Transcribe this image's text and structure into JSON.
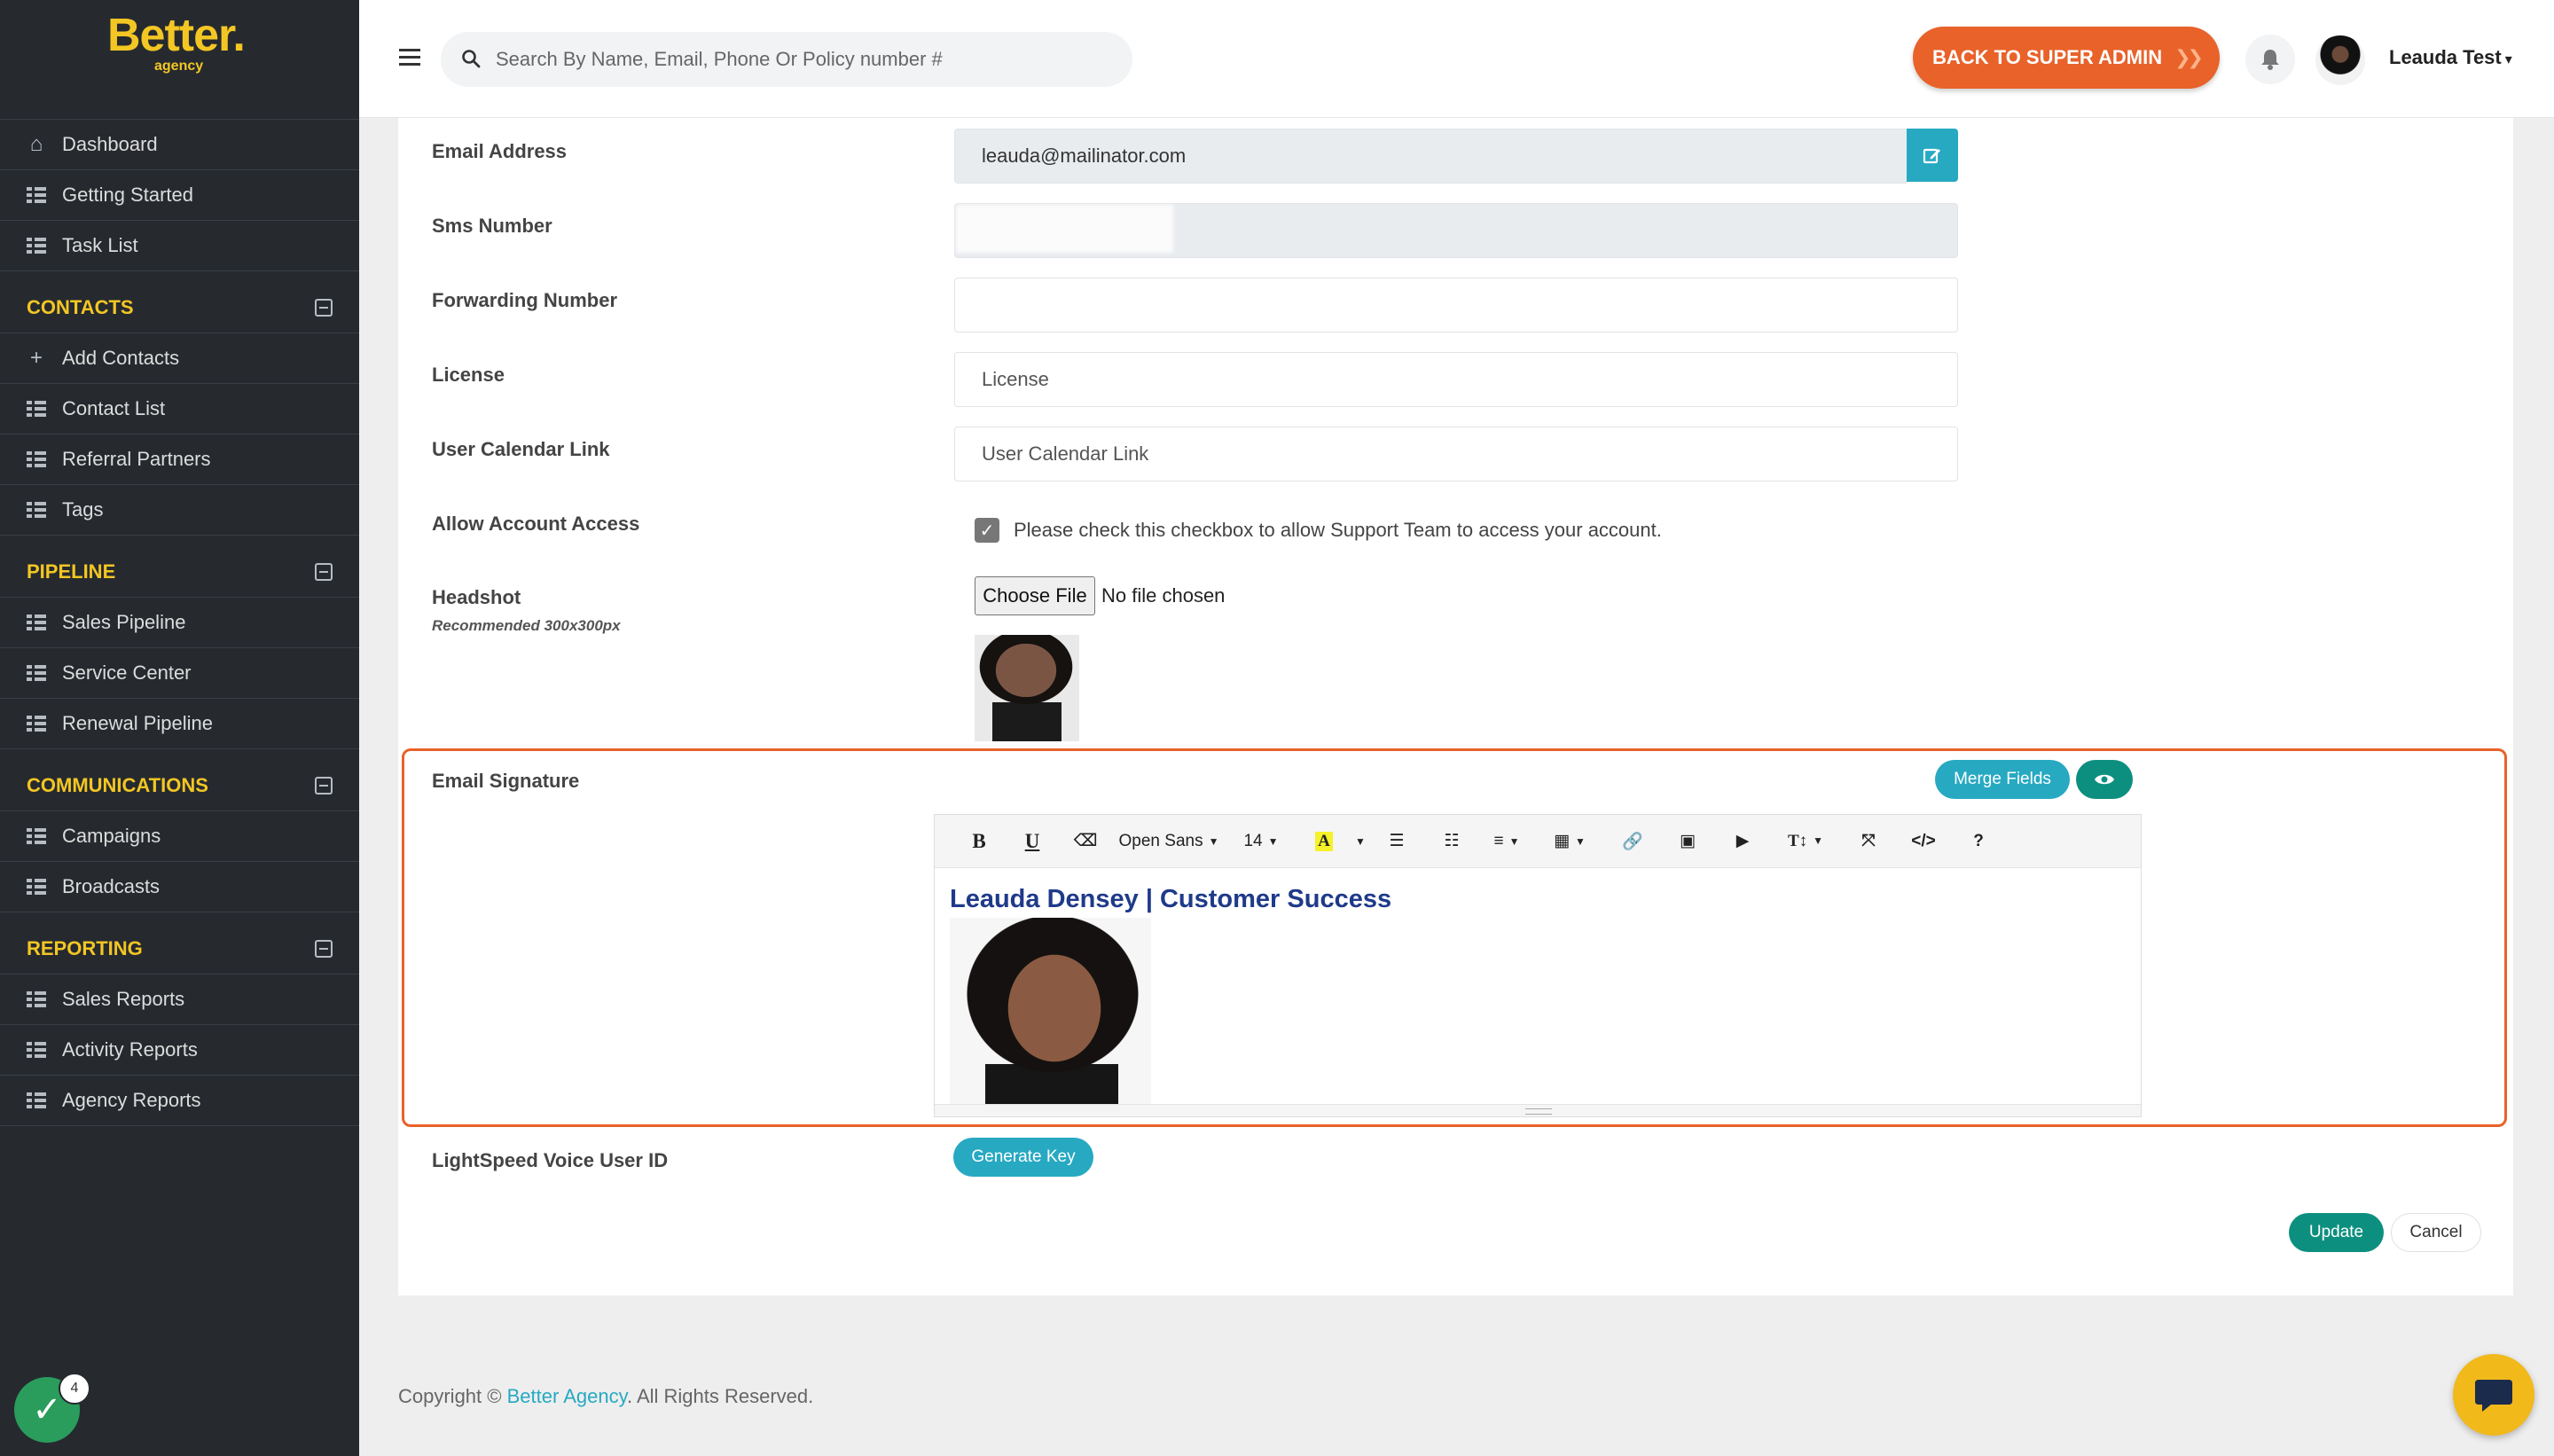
{
  "brand": {
    "name": "Better.",
    "sub": "agency"
  },
  "sidebar": {
    "top_items": [
      {
        "label": "Dashboard",
        "icon": "home-icon"
      },
      {
        "label": "Getting Started",
        "icon": "list-icon"
      },
      {
        "label": "Task List",
        "icon": "list-icon"
      }
    ],
    "sections": [
      {
        "title": "CONTACTS",
        "items": [
          {
            "label": "Add Contacts",
            "icon": "plus-icon"
          },
          {
            "label": "Contact List",
            "icon": "list-icon"
          },
          {
            "label": "Referral Partners",
            "icon": "list-icon"
          },
          {
            "label": "Tags",
            "icon": "list-icon"
          }
        ]
      },
      {
        "title": "PIPELINE",
        "items": [
          {
            "label": "Sales Pipeline",
            "icon": "list-icon"
          },
          {
            "label": "Service Center",
            "icon": "list-icon"
          },
          {
            "label": "Renewal Pipeline",
            "icon": "list-icon"
          }
        ]
      },
      {
        "title": "COMMUNICATIONS",
        "items": [
          {
            "label": "Campaigns",
            "icon": "list-icon"
          },
          {
            "label": "Broadcasts",
            "icon": "list-icon"
          }
        ]
      },
      {
        "title": "REPORTING",
        "items": [
          {
            "label": "Sales Reports",
            "icon": "list-icon"
          },
          {
            "label": "Activity Reports",
            "icon": "list-icon"
          },
          {
            "label": "Agency Reports",
            "icon": "list-icon"
          }
        ]
      }
    ],
    "badge_count": "4"
  },
  "topbar": {
    "search_placeholder": "Search By Name, Email, Phone Or Policy number #",
    "super_admin_label": "BACK TO SUPER ADMIN",
    "user_name": "Leauda Test"
  },
  "form": {
    "email_label": "Email Address",
    "email_value": "leauda@mailinator.com",
    "sms_label": "Sms Number",
    "forwarding_label": "Forwarding Number",
    "license_label": "License",
    "license_placeholder": "License",
    "calendar_label": "User Calendar Link",
    "calendar_placeholder": "User Calendar Link",
    "access_label": "Allow Account Access",
    "access_text": "Please check this checkbox to allow Support Team to access your account.",
    "headshot_label": "Headshot",
    "headshot_hint": "Recommended 300x300px",
    "file_button": "Choose File",
    "file_status": "No file chosen",
    "signature_label": "Email Signature",
    "merge_fields": "Merge Fields",
    "signature_heading": "Leauda Densey | Customer Success",
    "lightspeed_label": "LightSpeed Voice User ID",
    "generate_key": "Generate Key",
    "update": "Update",
    "cancel": "Cancel"
  },
  "editor_toolbar": {
    "font_family": "Open Sans",
    "font_size": "14"
  },
  "footer": {
    "prefix": "Copyright © ",
    "brand": "Better Agency",
    "suffix": ". All Rights Reserved."
  },
  "colors": {
    "sidebar_bg": "#262a2f",
    "brand_yellow": "#f3c623",
    "accent_orange": "#e8622a",
    "accent_teal": "#27a9c2",
    "accent_green": "#0d8f7f"
  }
}
